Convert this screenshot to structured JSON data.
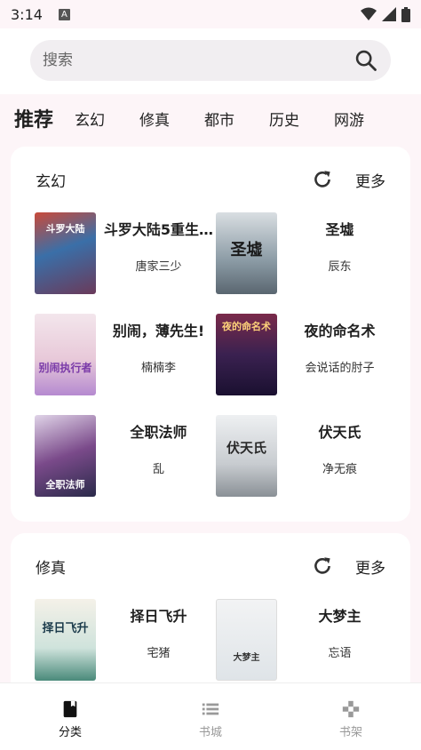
{
  "status_bar": {
    "time": "3:14",
    "notification_badge": "A"
  },
  "search": {
    "placeholder": "搜索"
  },
  "tabs": {
    "main": "推荐",
    "items": [
      "玄幻",
      "修真",
      "都市",
      "历史",
      "网游"
    ]
  },
  "sections": [
    {
      "title": "玄幻",
      "more_label": "更多",
      "books": [
        {
          "name": "斗罗大陆5重生…",
          "author": "唐家三少",
          "cover_text": "斗罗大陆",
          "cover_bg": "#3a6fa8"
        },
        {
          "name": "圣墟",
          "author": "辰东",
          "cover_text": "圣墟",
          "cover_bg": "#8a9aa4"
        },
        {
          "name": "别闹，薄先生!",
          "author": "楠楠李",
          "cover_text": "别闹执行者",
          "cover_bg": "#e8c9d9"
        },
        {
          "name": "夜的命名术",
          "author": "会说话的肘子",
          "cover_text": "夜的命名术",
          "cover_bg": "#3a2150"
        },
        {
          "name": "全职法师",
          "author": "乱",
          "cover_text": "全职法师",
          "cover_bg": "#7a4a8a"
        },
        {
          "name": "伏天氏",
          "author": "净无痕",
          "cover_text": "伏天氏",
          "cover_bg": "#c8ccd0"
        }
      ]
    },
    {
      "title": "修真",
      "more_label": "更多",
      "books": [
        {
          "name": "择日飞升",
          "author": "宅猪",
          "cover_text": "择日飞升",
          "cover_bg": "#cfe3dc"
        },
        {
          "name": "大梦主",
          "author": "忘语",
          "cover_text": "大梦主",
          "cover_bg": "#dfe4e8"
        }
      ]
    }
  ],
  "bottom_nav": [
    {
      "label": "分类",
      "icon": "book-icon",
      "active": true
    },
    {
      "label": "书城",
      "icon": "list-icon",
      "active": false
    },
    {
      "label": "书架",
      "icon": "gamepad-icon",
      "active": false
    }
  ]
}
